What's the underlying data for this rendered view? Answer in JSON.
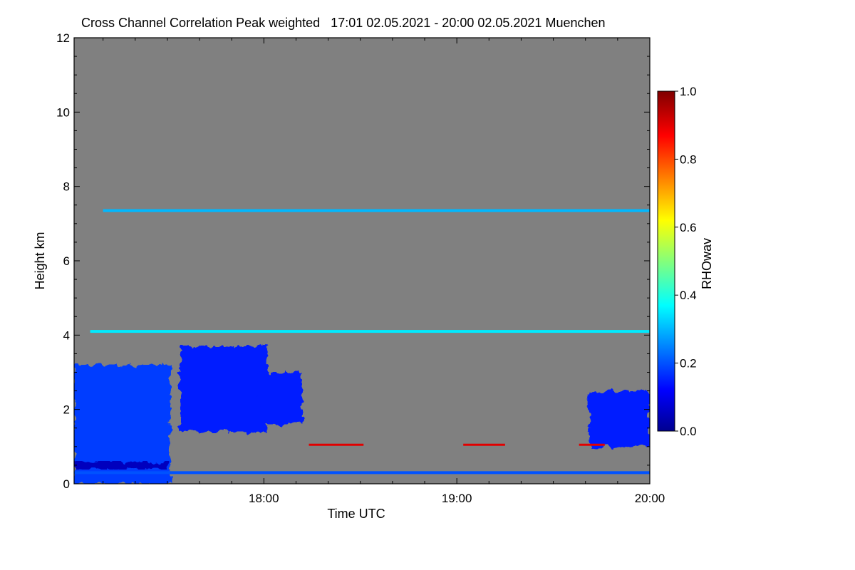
{
  "chart_data": {
    "type": "heatmap",
    "title": "Cross Channel Correlation Peak weighted   17:01 02.05.2021 - 20:00 02.05.2021 Muenchen",
    "xlabel": "Time UTC",
    "ylabel": "Height km",
    "colorbar_label": "RHOwav",
    "x_range": [
      "17:01",
      "20:00"
    ],
    "x_ticks": [
      "18:00",
      "19:00",
      "20:00"
    ],
    "y_range": [
      0,
      12
    ],
    "y_ticks": [
      "0",
      "2",
      "4",
      "6",
      "8",
      "10",
      "12"
    ],
    "colorbar_range": [
      0.0,
      1.0
    ],
    "colorbar_ticks": [
      "0.0",
      "0.2",
      "0.4",
      "0.6",
      "0.8",
      "1.0"
    ],
    "background_color": "#808080",
    "colormap": [
      "#00008f",
      "#0000ff",
      "#00ffff",
      "#ffff00",
      "#ff0000",
      "#800000"
    ],
    "features": [
      {
        "feature": "surface layer",
        "time_start": "17:01",
        "time_end": "17:31",
        "height_bottom_km": 0.0,
        "height_top_km": 3.2,
        "rho": 0.18
      },
      {
        "feature": "near-surface band",
        "time_start": "17:01",
        "time_end": "17:30",
        "height_bottom_km": 0.4,
        "height_top_km": 0.6,
        "rho": 0.05
      },
      {
        "feature": "elevated cloud",
        "time_start": "17:34",
        "time_end": "18:01",
        "height_bottom_km": 1.4,
        "height_top_km": 3.7,
        "rho": 0.15
      },
      {
        "feature": "elevated cloud",
        "time_start": "17:58",
        "time_end": "18:12",
        "height_bottom_km": 1.6,
        "height_top_km": 3.0,
        "rho": 0.15
      },
      {
        "feature": "evening cloud",
        "time_start": "19:41",
        "time_end": "20:00",
        "height_bottom_km": 1.0,
        "height_top_km": 2.5,
        "rho": 0.15
      },
      {
        "feature": "level line",
        "time_start": "17:01",
        "time_end": "20:00",
        "height_km": 0.3,
        "rho": 0.2
      },
      {
        "feature": "level line",
        "time_start": "17:06",
        "time_end": "20:00",
        "height_km": 4.1,
        "rho": 0.35
      },
      {
        "feature": "level line",
        "time_start": "17:10",
        "time_end": "20:00",
        "height_km": 7.35,
        "rho": 0.3
      },
      {
        "feature": "red streak",
        "time_start": "18:14",
        "time_end": "18:31",
        "height_km": 1.05,
        "rho": 0.9
      },
      {
        "feature": "red streak",
        "time_start": "19:02",
        "time_end": "19:15",
        "height_km": 1.05,
        "rho": 0.9
      },
      {
        "feature": "red streak",
        "time_start": "19:38",
        "time_end": "19:46",
        "height_km": 1.05,
        "rho": 0.9
      }
    ]
  }
}
